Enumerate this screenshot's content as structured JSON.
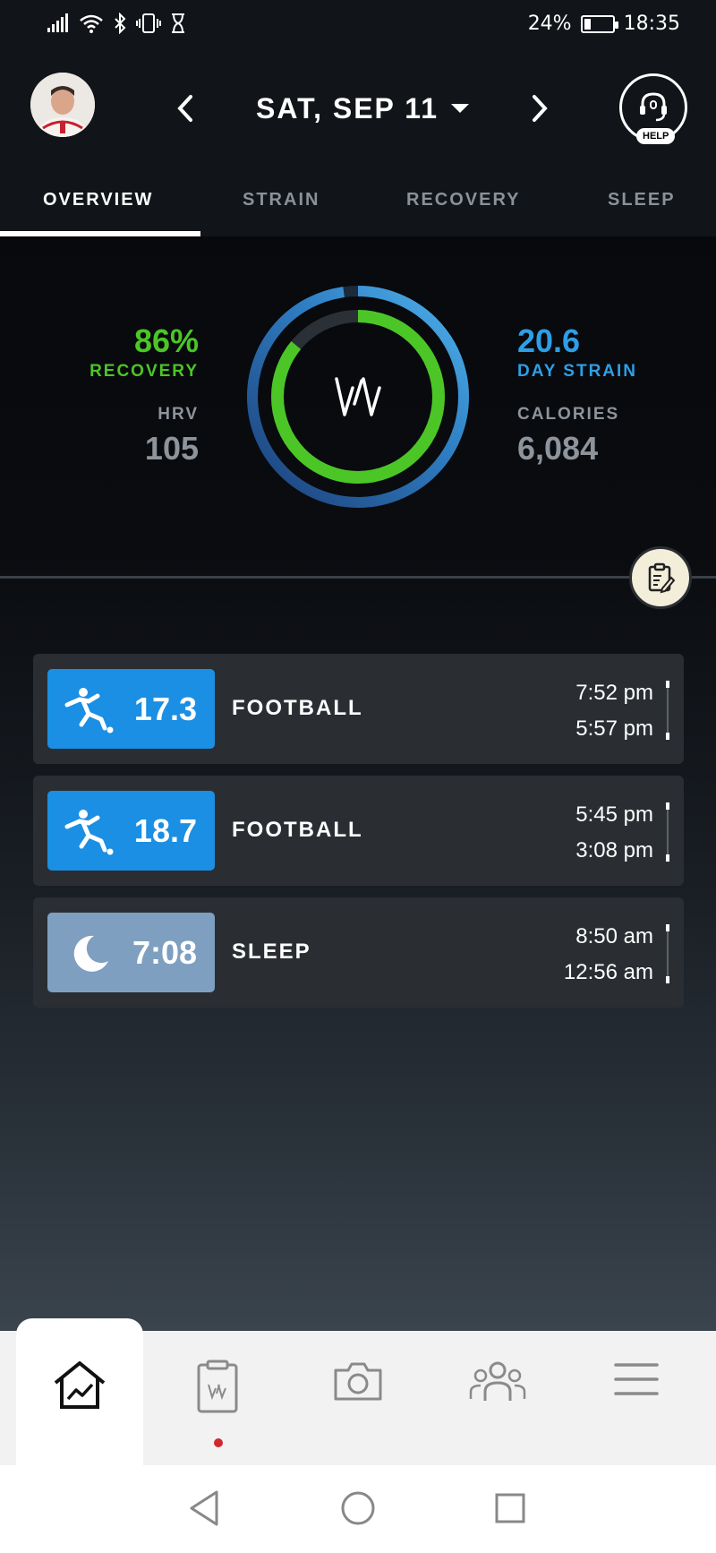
{
  "status_bar": {
    "battery": "24%",
    "battery_level": 0.24,
    "time": "18:35",
    "icons": [
      "signal-icon",
      "wifi-icon",
      "bluetooth-icon",
      "vibrate-icon",
      "hourglass-icon"
    ]
  },
  "header": {
    "date": "SAT, SEP 11",
    "help_label": "HELP"
  },
  "tabs": [
    {
      "label": "OVERVIEW",
      "active": true
    },
    {
      "label": "STRAIN",
      "active": false
    },
    {
      "label": "RECOVERY",
      "active": false
    },
    {
      "label": "SLEEP",
      "active": false
    }
  ],
  "overview": {
    "recovery_value": "86%",
    "recovery_label": "RECOVERY",
    "hrv_label": "HRV",
    "hrv_value": "105",
    "strain_value": "20.6",
    "strain_label": "DAY STRAIN",
    "calories_label": "CALORIES",
    "calories_value": "6,084",
    "recovery_fraction": 0.86,
    "strain_fraction": 0.978,
    "colors": {
      "recovery": "#4bc626",
      "strain": "#2e9fe6",
      "muted": "#8d949b"
    }
  },
  "activities": [
    {
      "type": "football",
      "icon": "football-player-icon",
      "score": "17.3",
      "title": "FOOTBALL",
      "end": "7:52 pm",
      "start": "5:57 pm",
      "color": "#1a8fe3"
    },
    {
      "type": "football",
      "icon": "football-player-icon",
      "score": "18.7",
      "title": "FOOTBALL",
      "end": "5:45 pm",
      "start": "3:08 pm",
      "color": "#1a8fe3"
    },
    {
      "type": "sleep",
      "icon": "moon-icon",
      "score": "7:08",
      "title": "SLEEP",
      "end": "8:50 am",
      "start": "12:56 am",
      "color": "#7e9fc0"
    }
  ],
  "bottom_nav": {
    "items": [
      "home-chart-icon",
      "journal-icon",
      "camera-icon",
      "team-icon",
      "menu-icon"
    ],
    "active": "home-chart-icon"
  }
}
